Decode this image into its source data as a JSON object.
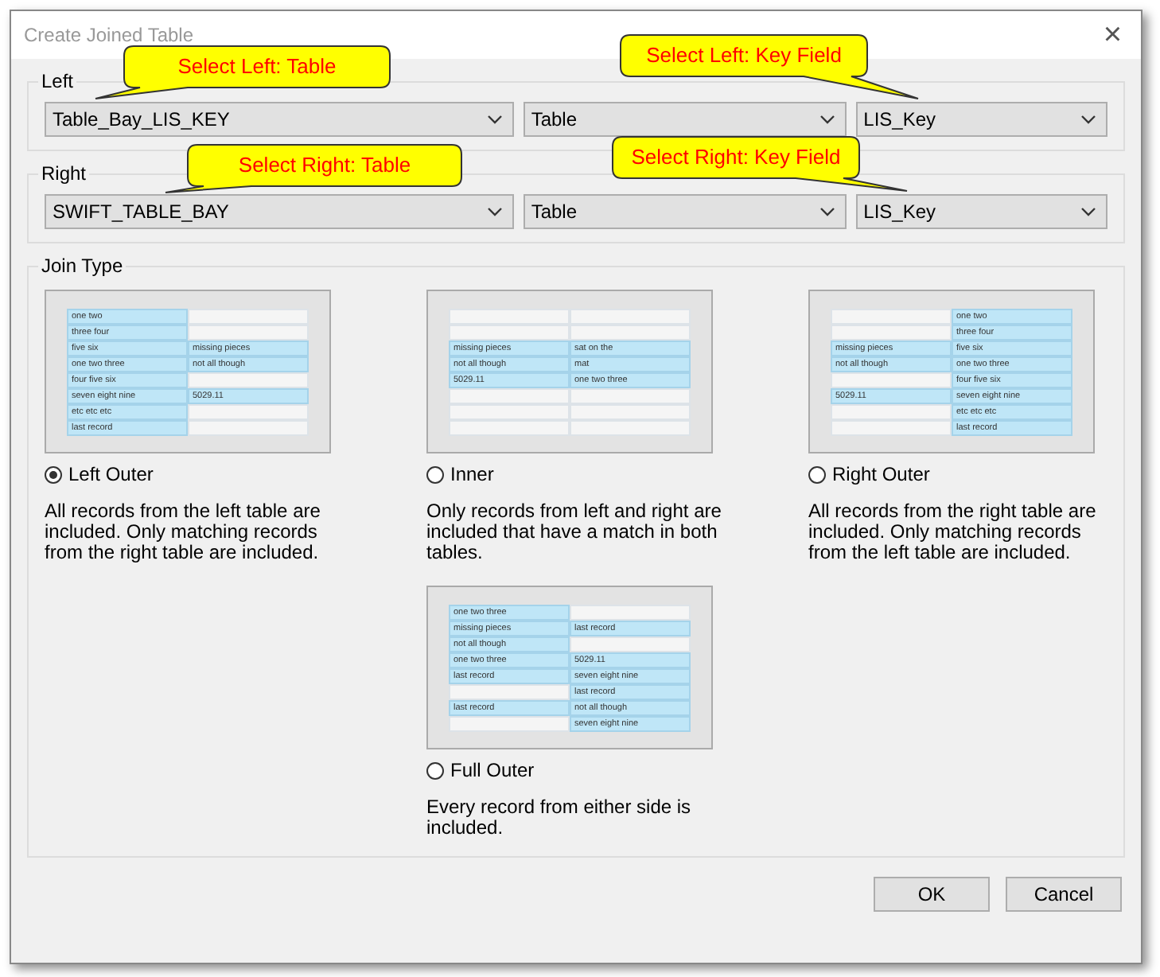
{
  "window": {
    "title": "Create Joined Table",
    "close": "×"
  },
  "groups": [
    {
      "label": "Left",
      "selects": [
        "Table_Bay_LIS_KEY",
        "Table",
        "LIS_Key"
      ]
    },
    {
      "label": "Right",
      "selects": [
        "SWIFT_TABLE_BAY",
        "Table",
        "LIS_Key"
      ]
    }
  ],
  "callouts": [
    {
      "text": "Select Left: Table",
      "kind": "left-table"
    },
    {
      "text": "Select Left:  Key Field",
      "kind": "left-key"
    },
    {
      "text": "Select Right:  Table",
      "kind": "right-table"
    },
    {
      "text": "Select Right:  Key Field",
      "kind": "right-key"
    }
  ],
  "join_type": {
    "label": "Join Type",
    "options": [
      {
        "label": "Left Outer",
        "selected": true,
        "description": "All records from the left table are included. Only matching records from the right table are included.",
        "rows": [
          [
            {
              "text": "one two",
              "highlighted": true
            },
            {
              "highlighted": false
            }
          ],
          [
            {
              "text": "three four",
              "highlighted": true
            },
            {
              "highlighted": false
            }
          ],
          [
            {
              "text": "five six",
              "highlighted": true
            },
            {
              "text": "missing pieces",
              "highlighted": true
            }
          ],
          [
            {
              "text": "one two three",
              "highlighted": true
            },
            {
              "text": "not all though",
              "highlighted": true
            }
          ],
          [
            {
              "text": "four five six",
              "highlighted": true
            },
            {
              "highlighted": false
            }
          ],
          [
            {
              "text": "seven eight nine",
              "highlighted": true
            },
            {
              "text": "5029.11",
              "highlighted": true
            }
          ],
          [
            {
              "text": "etc etc etc",
              "highlighted": true
            },
            {
              "highlighted": false
            }
          ],
          [
            {
              "text": "last record",
              "highlighted": true
            },
            {
              "highlighted": false
            }
          ]
        ]
      },
      {
        "label": "Inner",
        "selected": false,
        "description": "Only records from left and right are included that have a match in both tables.",
        "rows": [
          [
            {
              "highlighted": false
            },
            {
              "highlighted": false
            }
          ],
          [
            {
              "highlighted": false
            },
            {
              "highlighted": false
            }
          ],
          [
            {
              "text": "missing pieces",
              "highlighted": true
            },
            {
              "text": "sat on the",
              "highlighted": true
            }
          ],
          [
            {
              "text": "not all though",
              "highlighted": true
            },
            {
              "text": "mat",
              "highlighted": true
            }
          ],
          [
            {
              "text": "5029.11",
              "highlighted": true
            },
            {
              "text": "one two three",
              "highlighted": true
            }
          ],
          [
            {
              "highlighted": false
            },
            {
              "highlighted": false
            }
          ],
          [
            {
              "highlighted": false
            },
            {
              "highlighted": false
            }
          ],
          [
            {
              "highlighted": false
            },
            {
              "highlighted": false
            }
          ]
        ]
      },
      {
        "label": "Right Outer",
        "selected": false,
        "description": "All records from the right table are included. Only matching records from the left table are included.",
        "rows": [
          [
            {
              "highlighted": false
            },
            {
              "text": "one two",
              "highlighted": true
            }
          ],
          [
            {
              "highlighted": false
            },
            {
              "text": "three four",
              "highlighted": true
            }
          ],
          [
            {
              "text": "missing pieces",
              "highlighted": true
            },
            {
              "text": "five six",
              "highlighted": true
            }
          ],
          [
            {
              "text": "not all though",
              "highlighted": true
            },
            {
              "text": "one two three",
              "highlighted": true
            }
          ],
          [
            {
              "highlighted": false
            },
            {
              "text": "four five six",
              "highlighted": true
            }
          ],
          [
            {
              "text": "5029.11",
              "highlighted": true
            },
            {
              "text": "seven eight nine",
              "highlighted": true
            }
          ],
          [
            {
              "highlighted": false
            },
            {
              "text": "etc etc etc",
              "highlighted": true
            }
          ],
          [
            {
              "highlighted": false
            },
            {
              "text": "last record",
              "highlighted": true
            }
          ]
        ]
      },
      {
        "label": "Full Outer",
        "selected": false,
        "description": "Every record from either side is included.",
        "rows": [
          [
            {
              "text": "one two three",
              "highlighted": true
            },
            {
              "highlighted": false
            }
          ],
          [
            {
              "text": "missing pieces",
              "highlighted": true
            },
            {
              "text": "last record",
              "highlighted": true
            }
          ],
          [
            {
              "text": "not all though",
              "highlighted": true
            },
            {
              "highlighted": false
            }
          ],
          [
            {
              "text": "one two three",
              "highlighted": true
            },
            {
              "text": "5029.11",
              "highlighted": true
            }
          ],
          [
            {
              "text": "last record",
              "highlighted": true
            },
            {
              "text": "seven eight nine",
              "highlighted": true
            }
          ],
          [
            {
              "highlighted": false
            },
            {
              "text": "last record",
              "highlighted": true
            }
          ],
          [
            {
              "text": "last record",
              "highlighted": true
            },
            {
              "text": "not all though",
              "highlighted": true
            }
          ],
          [
            {
              "highlighted": false
            },
            {
              "text": "seven eight nine",
              "highlighted": true
            }
          ]
        ]
      }
    ]
  },
  "buttons": [
    "OK",
    "Cancel"
  ]
}
